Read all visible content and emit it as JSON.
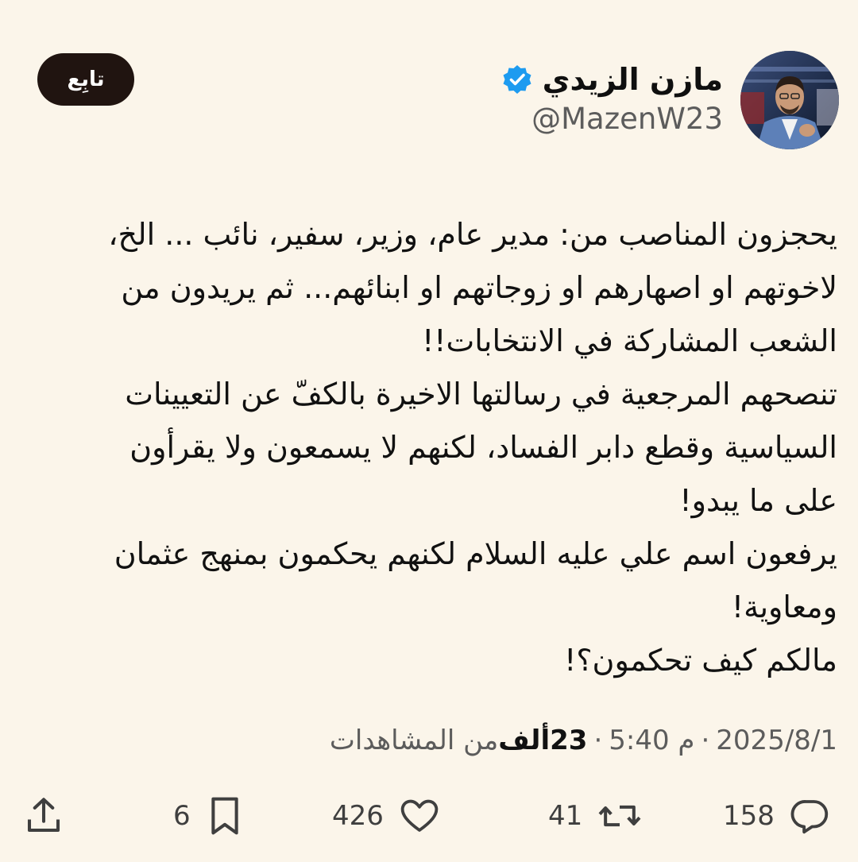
{
  "author": {
    "display_name": "مازن الزيدي",
    "handle": "@MazenW23",
    "verified": true,
    "verified_color": "#1d9bf0"
  },
  "follow_button": {
    "label": "تابِع"
  },
  "tweet": {
    "lines": [
      "يحجزون المناصب من: مدير عام، وزير، سفير، نائب ... الخ،",
      "لاخوتهم او اصهارهم او زوجاتهم او ابنائهم... ثم يريدون من",
      "الشعب المشاركة في الانتخابات!!",
      "تنصحهم المرجعية في رسالتها الاخيرة بالكفّ عن التعيينات",
      "السياسية وقطع دابر الفساد، لكنهم لا يسمعون ولا يقرأون",
      "على ما يبدو!",
      "يرفعون اسم علي عليه السلام لكنهم يحكمون بمنهج عثمان",
      "ومعاوية!",
      "مالكم كيف تحكمون؟!"
    ]
  },
  "meta": {
    "date": "2025/8/1",
    "time": "5:40 م",
    "views_count": "23ألف",
    "views_label": "من المشاهدات",
    "separator": "·"
  },
  "actions": {
    "replies": "158",
    "retweets": "41",
    "likes": "426",
    "bookmarks": "6"
  },
  "icons": {
    "reply": "speech-bubble-icon",
    "retweet": "retweet-arrows-icon",
    "like": "heart-icon",
    "bookmark": "bookmark-icon",
    "share": "share-upload-icon",
    "verified": "verified-badge-icon"
  }
}
